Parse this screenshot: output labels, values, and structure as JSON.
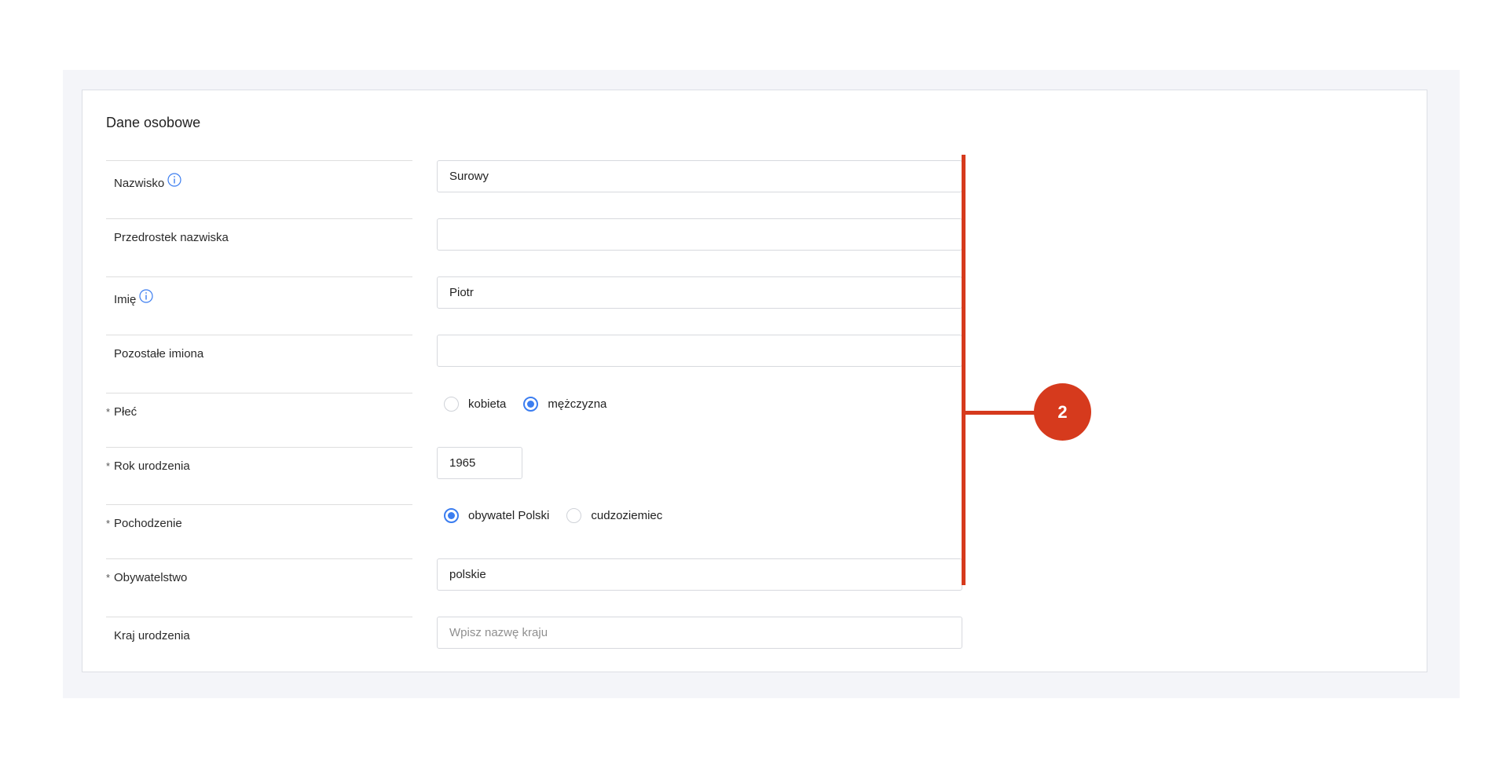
{
  "section": {
    "title": "Dane osobowe"
  },
  "fields": {
    "nazwisko": {
      "label": "Nazwisko",
      "value": "Surowy"
    },
    "przedrostek": {
      "label": "Przedrostek nazwiska",
      "value": ""
    },
    "imie": {
      "label": "Imię",
      "value": "Piotr"
    },
    "pozostale_imiona": {
      "label": "Pozostałe imiona",
      "value": ""
    },
    "plec": {
      "label": "Płeć",
      "required_mark": "*",
      "options": [
        "kobieta",
        "mężczyzna"
      ],
      "selected": "mężczyzna"
    },
    "rok_urodzenia": {
      "label": "Rok urodzenia",
      "required_mark": "*",
      "value": "1965"
    },
    "pochodzenie": {
      "label": "Pochodzenie",
      "required_mark": "*",
      "options": [
        "obywatel Polski",
        "cudzoziemiec"
      ],
      "selected": "obywatel Polski"
    },
    "obywatelstwo": {
      "label": "Obywatelstwo",
      "required_mark": "*",
      "value": "polskie"
    },
    "kraj_urodzenia": {
      "label": "Kraj urodzenia",
      "value": "",
      "placeholder": "Wpisz nazwę kraju"
    }
  },
  "annotation": {
    "badge_number": "2"
  },
  "colors": {
    "accent_blue": "#3b7df0",
    "annotation_red": "#d63a1d",
    "panel_bg": "#f4f5f9"
  },
  "icons": {
    "info": "info-icon"
  }
}
